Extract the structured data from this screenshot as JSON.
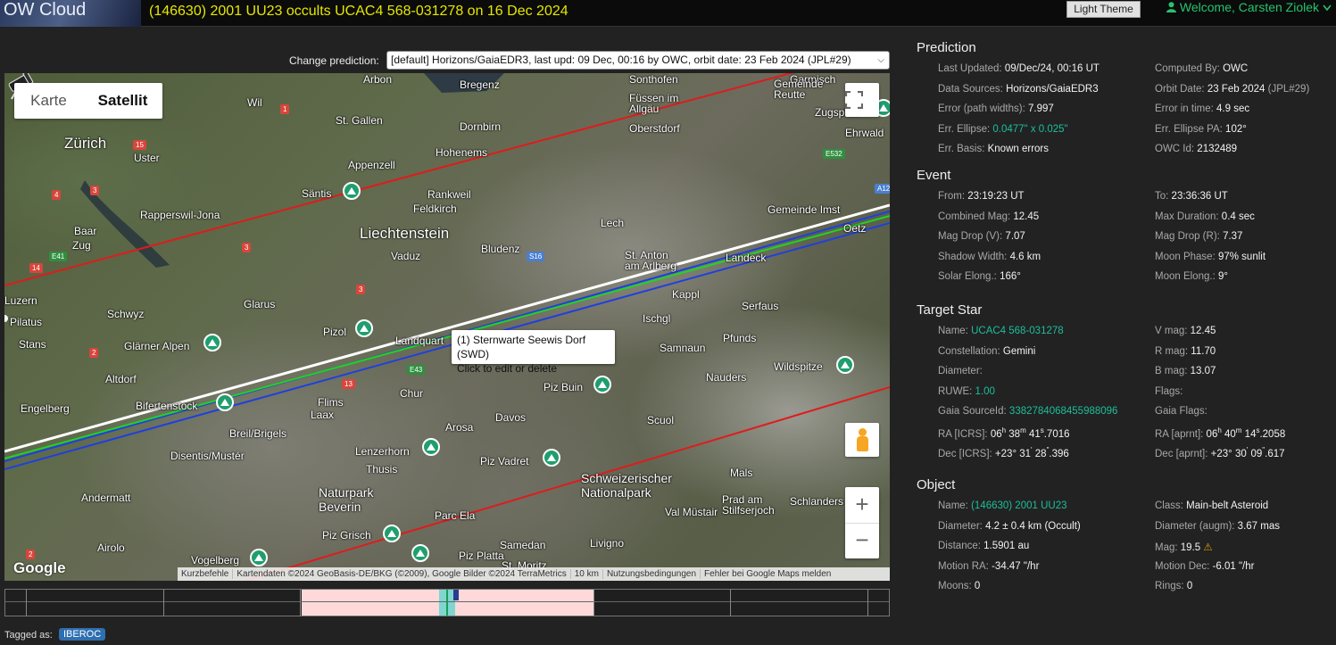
{
  "header": {
    "logo": "OW Cloud",
    "title": "(146630) 2001 UU23 occults UCAC4 568-031278 on 16 Dec 2024",
    "theme_button": "Light Theme",
    "welcome": "Welcome, Carsten Ziolek",
    "user_icon": "user-icon",
    "caret_icon": "chevron-down-icon"
  },
  "prediction_selector": {
    "label": "Change prediction:",
    "selected": "[default] Horizons/GaiaEDR3, last upd: 09 Dec, 00:16 by OWC, orbit date: 23 Feb 2024 (JPL#29)"
  },
  "map": {
    "type_options": [
      "Karte",
      "Satellit"
    ],
    "active_type": "Satellit",
    "fullscreen_icon": "fullscreen-icon",
    "pegman_icon": "pegman-icon",
    "zoom_in": "+",
    "zoom_out": "−",
    "tooltip": {
      "line1": "(1) Sternwarte Seewis Dorf (SWD)",
      "line2": "Click to edit or delete"
    },
    "google_logo": "Google",
    "attribution": [
      "Kurzbefehle",
      "Kartendaten ©2024 GeoBasis-DE/BKG (©2009), Google Bilder ©2024 TerraMetrics",
      "10 km",
      "Nutzungsbedingungen",
      "Fehler bei Google Maps melden"
    ],
    "places": [
      {
        "name": "Zürich",
        "big": true
      },
      {
        "name": "Liechtenstein",
        "big": true
      },
      {
        "name": "St. Gallen"
      },
      {
        "name": "Bregenz"
      },
      {
        "name": "Arbon"
      },
      {
        "name": "Sonthofen"
      },
      {
        "name": "Garmisch"
      },
      {
        "name": "Gemeinde Reutte"
      },
      {
        "name": "Füssen im Allgäu"
      },
      {
        "name": "Dornbirn"
      },
      {
        "name": "Oberstdorf"
      },
      {
        "name": "Appenzell"
      },
      {
        "name": "Hohenems"
      },
      {
        "name": "Ehrwald"
      },
      {
        "name": "Zugspitze"
      },
      {
        "name": "Uster"
      },
      {
        "name": "Wil"
      },
      {
        "name": "Säntis"
      },
      {
        "name": "Rankweil"
      },
      {
        "name": "Feldkirch"
      },
      {
        "name": "Lech"
      },
      {
        "name": "Gemeinde Imst"
      },
      {
        "name": "Rapperswil-Jona"
      },
      {
        "name": "Baar"
      },
      {
        "name": "Zug"
      },
      {
        "name": "Vaduz"
      },
      {
        "name": "Bludenz"
      },
      {
        "name": "St. Anton am Arlberg"
      },
      {
        "name": "Landeck"
      },
      {
        "name": "Oetz"
      },
      {
        "name": "Luzern"
      },
      {
        "name": "Glarus"
      },
      {
        "name": "Kappl"
      },
      {
        "name": "Serfaus"
      },
      {
        "name": "Pilatus"
      },
      {
        "name": "Schwyz"
      },
      {
        "name": "Ischgl"
      },
      {
        "name": "Stans"
      },
      {
        "name": "Glärner Alpen"
      },
      {
        "name": "Pizol"
      },
      {
        "name": "Landquart"
      },
      {
        "name": "Samnaun"
      },
      {
        "name": "Pfunds"
      },
      {
        "name": "Wildspitze"
      },
      {
        "name": "Altdorf"
      },
      {
        "name": "Nauders"
      },
      {
        "name": "Piz Buin"
      },
      {
        "name": "Chur"
      },
      {
        "name": "Engelberg"
      },
      {
        "name": "Bifertenstock"
      },
      {
        "name": "Flims"
      },
      {
        "name": "Laax"
      },
      {
        "name": "Davos"
      },
      {
        "name": "Scuol"
      },
      {
        "name": "Breil/Brigels"
      },
      {
        "name": "Arosa"
      },
      {
        "name": "Disentis/Mustér"
      },
      {
        "name": "Lenzerhorn"
      },
      {
        "name": "Thusis"
      },
      {
        "name": "Piz Vadret"
      },
      {
        "name": "Mals"
      },
      {
        "name": "Schweizerischer Nationalpark"
      },
      {
        "name": "Andermatt"
      },
      {
        "name": "Naturpark Beverin"
      },
      {
        "name": "Prad am Stilfserjoch"
      },
      {
        "name": "Schlanders"
      },
      {
        "name": "Val Müstair"
      },
      {
        "name": "Parc Ela"
      },
      {
        "name": "Piz Grisch"
      },
      {
        "name": "Airolo"
      },
      {
        "name": "Vogelberg"
      },
      {
        "name": "Piz Platta"
      },
      {
        "name": "Samedan"
      },
      {
        "name": "Livigno"
      },
      {
        "name": "St. Moritz"
      }
    ],
    "roads": [
      "1",
      "15",
      "4",
      "14",
      "E41",
      "3",
      "3",
      "3",
      "2",
      "2",
      "13",
      "E43",
      "S16",
      "E532",
      "A12"
    ]
  },
  "timeline": {},
  "tags": {
    "label": "Tagged as:",
    "items": [
      "IBEROC"
    ]
  },
  "prediction": {
    "heading": "Prediction",
    "left": [
      {
        "k": "Last Updated:",
        "v": "09/Dec/24, 00:16 UT"
      },
      {
        "k": "Data Sources:",
        "v": "Horizons/GaiaEDR3"
      },
      {
        "k": "Error (path widths):",
        "v": "7.997"
      },
      {
        "k": "Err. Ellipse:",
        "v": "0.0477\" x 0.025\"",
        "teal": true
      },
      {
        "k": "Err. Basis:",
        "v": "Known errors"
      }
    ],
    "right": [
      {
        "k": "Computed By:",
        "v": "OWC"
      },
      {
        "k": "Orbit Date:",
        "v": "23 Feb 2024",
        "u": "(JPL#29)"
      },
      {
        "k": "Error in time:",
        "v": "4.9 sec"
      },
      {
        "k": "Err. Ellipse PA:",
        "v": "102°"
      },
      {
        "k": "OWC Id:",
        "v": "2132489"
      }
    ]
  },
  "event": {
    "heading": "Event",
    "left": [
      {
        "k": "From:",
        "v": "23:19:23 UT"
      },
      {
        "k": "Combined Mag:",
        "v": "12.45"
      },
      {
        "k": "Mag Drop (V):",
        "v": "7.07"
      },
      {
        "k": "Shadow Width:",
        "v": "4.6 km"
      },
      {
        "k": "Solar Elong.:",
        "v": "166°"
      }
    ],
    "right": [
      {
        "k": "To:",
        "v": "23:36:36 UT"
      },
      {
        "k": "Max Duration:",
        "v": "0.4 sec"
      },
      {
        "k": "Mag Drop (R):",
        "v": "7.37"
      },
      {
        "k": "Moon Phase:",
        "v": "97% sunlit"
      },
      {
        "k": "Moon Elong.:",
        "v": "9°"
      }
    ]
  },
  "target_star": {
    "heading": "Target Star",
    "name_k": "Name:",
    "name_v": "UCAC4 568-031278",
    "const_k": "Constellation:",
    "const_v": "Gemini",
    "diam_k": "Diameter:",
    "ruwe_k": "RUWE:",
    "ruwe_v": "1.00",
    "gaia_k": "Gaia SourceId:",
    "gaia_v": "3382784068455988096",
    "ra_k": "RA [ICRS]:",
    "ra_h": "06",
    "ra_m": "38",
    "ra_s": "41",
    "ra_f": ".7016",
    "dec_k": "Dec [ICRS]:",
    "dec_d": "+23",
    "dec_am": "31",
    "dec_as": "28",
    "dec_f": ".396",
    "vmag_k": "V mag:",
    "vmag_v": "12.45",
    "rmag_k": "R mag:",
    "rmag_v": "11.70",
    "bmag_k": "B mag:",
    "bmag_v": "13.07",
    "flags_k": "Flags:",
    "gflags_k": "Gaia Flags:",
    "raa_k": "RA [aprnt]:",
    "raa_h": "06",
    "raa_m": "40",
    "raa_s": "14",
    "raa_f": ".2058",
    "deca_k": "Dec [aprnt]:",
    "deca_d": "+23",
    "deca_am": "30",
    "deca_as": "09",
    "deca_f": ".617"
  },
  "object": {
    "heading": "Object",
    "name_k": "Name:",
    "name_v": "(146630) 2001 UU23",
    "diam_k": "Diameter:",
    "diam_v": "4.2 ± 0.4 km",
    "diam_u": "(Occult)",
    "dist_k": "Distance:",
    "dist_v": "1.5901 au",
    "mra_k": "Motion RA:",
    "mra_v": "-34.47 \"/hr",
    "moons_k": "Moons:",
    "moons_v": "0",
    "class_k": "Class:",
    "class_v": "Main-belt Asteroid",
    "diaug_k": "Diameter (augm):",
    "diaug_v": "3.67 mas",
    "mag_k": "Mag:",
    "mag_v": "19.5",
    "mag_icon": "warning-icon",
    "mdec_k": "Motion Dec:",
    "mdec_v": "-6.01 \"/hr",
    "rings_k": "Rings:",
    "rings_v": "0"
  }
}
